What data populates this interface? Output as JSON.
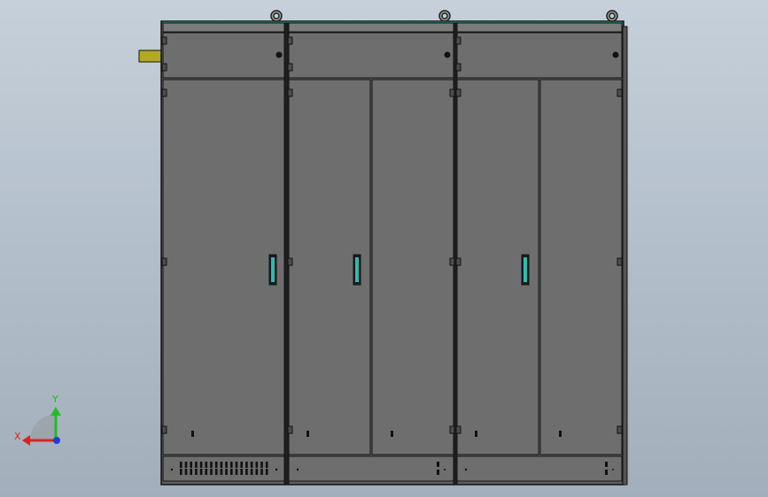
{
  "viewport": {
    "background_top": "#c6d0da",
    "background_bottom": "#a3aebb"
  },
  "model": {
    "type": "electrical-enclosure-cabinet",
    "bays": 3,
    "colors": {
      "panel": "#6e6e6e",
      "outline": "#141414",
      "frame": "#5e5e5e",
      "top_strip": "#7b7b7b",
      "lifting_eye": "#9a9a9a",
      "handle_accent": "#2fb9b0",
      "side_tab": "#b2aa1e"
    }
  },
  "triad": {
    "x_label": "X",
    "y_label": "Y",
    "x_color": "#e02020",
    "y_color": "#1fbf1f",
    "z_color": "#1f3fd8"
  }
}
